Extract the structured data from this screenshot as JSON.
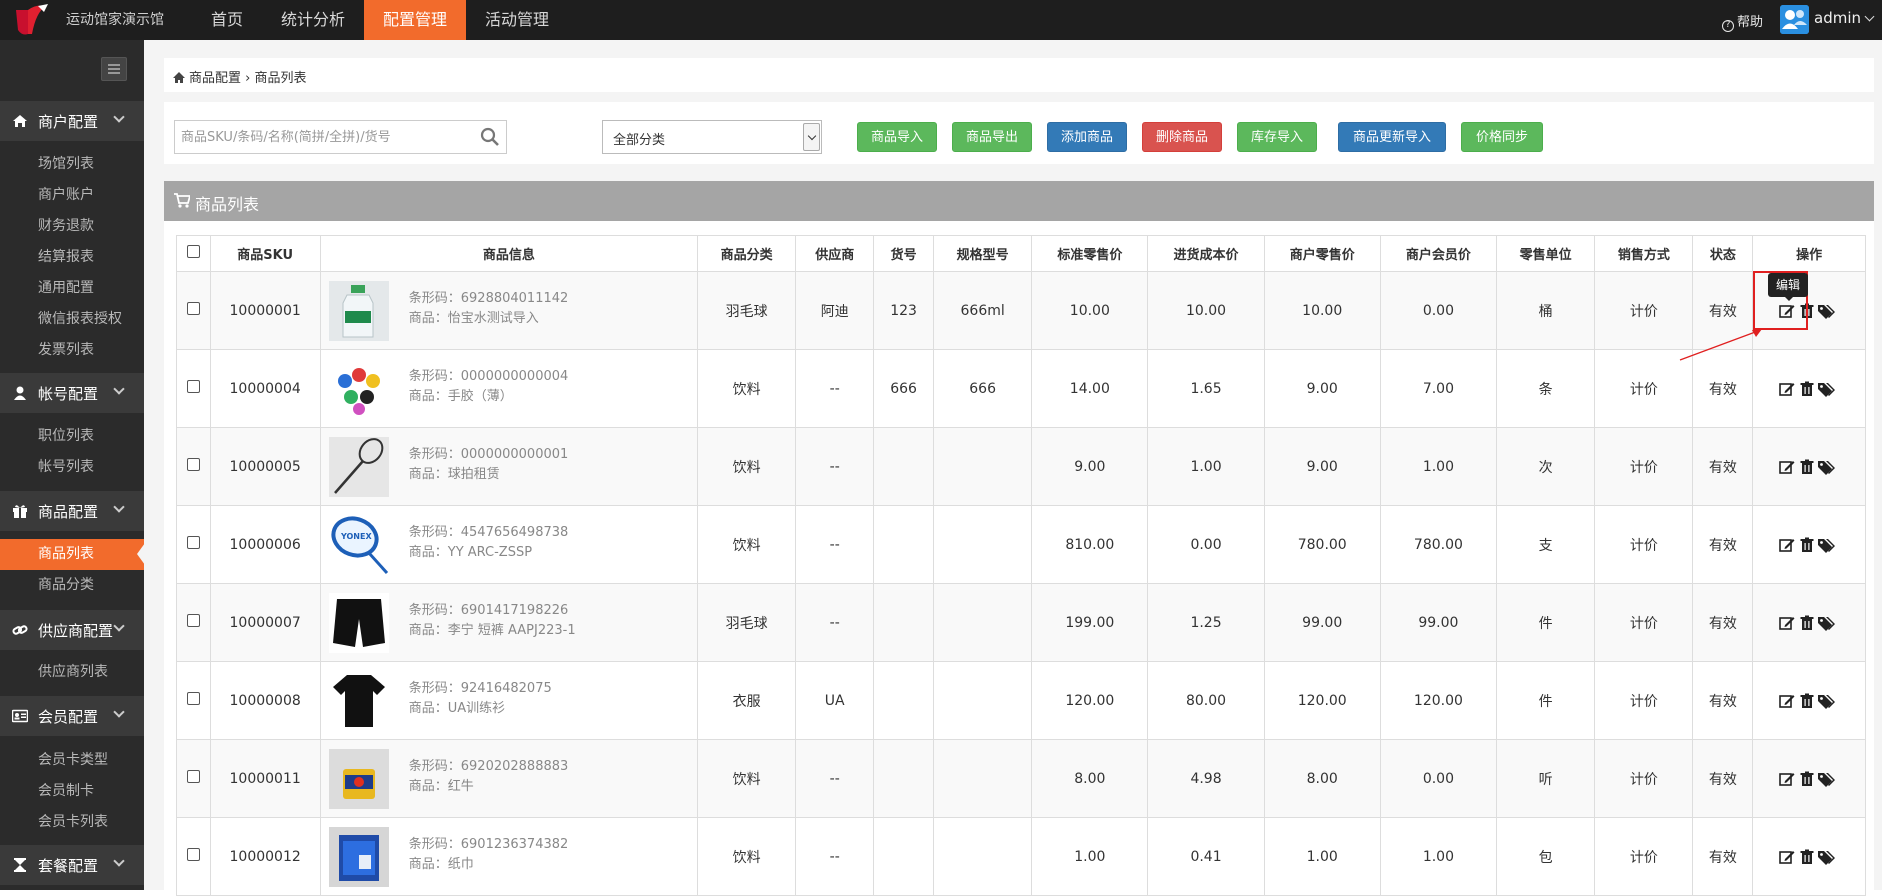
{
  "app": {
    "logo_text": "运动馆家演示馆",
    "nav": [
      {
        "label": "首页",
        "active": false
      },
      {
        "label": "统计分析",
        "active": false
      },
      {
        "label": "配置管理",
        "active": true
      },
      {
        "label": "活动管理",
        "active": false
      }
    ],
    "help_label": "帮助",
    "user_label": "admin",
    "accent_color": "#f26b2c"
  },
  "sidebar": {
    "groups": [
      {
        "label": "商户配置",
        "icon": "home-icon",
        "items": [
          {
            "label": "场馆列表"
          },
          {
            "label": "商户账户"
          },
          {
            "label": "财务退款"
          },
          {
            "label": "结算报表"
          },
          {
            "label": "通用配置"
          },
          {
            "label": "微信报表授权"
          },
          {
            "label": "发票列表"
          }
        ]
      },
      {
        "label": "帐号配置",
        "icon": "user-icon",
        "items": [
          {
            "label": "职位列表"
          },
          {
            "label": "帐号列表"
          }
        ]
      },
      {
        "label": "商品配置",
        "icon": "gift-icon",
        "items": [
          {
            "label": "商品列表",
            "active": true
          },
          {
            "label": "商品分类"
          }
        ]
      },
      {
        "label": "供应商配置",
        "icon": "link-icon",
        "items": [
          {
            "label": "供应商列表"
          }
        ]
      },
      {
        "label": "会员配置",
        "icon": "id-card-icon",
        "items": [
          {
            "label": "会员卡类型"
          },
          {
            "label": "会员制卡"
          },
          {
            "label": "会员卡列表"
          }
        ]
      },
      {
        "label": "套餐配置",
        "icon": "hourglass-icon",
        "items": []
      }
    ]
  },
  "breadcrumb": {
    "part1": "商品配置",
    "separator": "›",
    "part2": "商品列表"
  },
  "toolbar": {
    "search_placeholder": "商品SKU/条码/名称(简拼/全拼)/货号",
    "category_value": "全部分类",
    "buttons": [
      {
        "label": "商品导入",
        "style": "green"
      },
      {
        "label": "商品导出",
        "style": "green"
      },
      {
        "label": "添加商品",
        "style": "blue"
      },
      {
        "label": "删除商品",
        "style": "red"
      },
      {
        "label": "库存导入",
        "style": "green"
      },
      {
        "label": "商品更新导入",
        "style": "blue"
      },
      {
        "label": "价格同步",
        "style": "green"
      }
    ]
  },
  "panel": {
    "title": "商品列表"
  },
  "table": {
    "headers": [
      "商品SKU",
      "商品信息",
      "商品分类",
      "供应商",
      "货号",
      "规格型号",
      "标准零售价",
      "进货成本价",
      "商户零售价",
      "商户会员价",
      "零售单位",
      "销售方式",
      "状态",
      "操作"
    ],
    "barcode_label": "条形码：",
    "name_label": "商品：",
    "rows": [
      {
        "sku": "10000001",
        "barcode": "6928804011142",
        "name": "怡宝水测试导入",
        "thumb": "water-bottle",
        "category": "羽毛球",
        "supplier": "阿迪",
        "item_no": "123",
        "spec": "666ml",
        "std_price": "10.00",
        "cost": "10.00",
        "retail": "10.00",
        "member": "0.00",
        "unit": "桶",
        "sale": "计价",
        "status": "有效"
      },
      {
        "sku": "10000004",
        "barcode": "0000000000004",
        "name": "手胶（薄）",
        "thumb": "grip-tapes",
        "category": "饮料",
        "supplier": "--",
        "item_no": "666",
        "spec": "666",
        "std_price": "14.00",
        "cost": "1.65",
        "retail": "9.00",
        "member": "7.00",
        "unit": "条",
        "sale": "计价",
        "status": "有效"
      },
      {
        "sku": "10000005",
        "barcode": "0000000000001",
        "name": "球拍租赁",
        "thumb": "racket-white",
        "category": "饮料",
        "supplier": "--",
        "item_no": "",
        "spec": "",
        "std_price": "9.00",
        "cost": "1.00",
        "retail": "9.00",
        "member": "1.00",
        "unit": "次",
        "sale": "计价",
        "status": "有效"
      },
      {
        "sku": "10000006",
        "barcode": "4547656498738",
        "name": "YY ARC-ZSSP",
        "thumb": "racket-blue",
        "category": "饮料",
        "supplier": "--",
        "item_no": "",
        "spec": "",
        "std_price": "810.00",
        "cost": "0.00",
        "retail": "780.00",
        "member": "780.00",
        "unit": "支",
        "sale": "计价",
        "status": "有效"
      },
      {
        "sku": "10000007",
        "barcode": "6901417198226",
        "name": "李宁 短裤 AAPJ223-1",
        "thumb": "shorts",
        "category": "羽毛球",
        "supplier": "--",
        "item_no": "",
        "spec": "",
        "std_price": "199.00",
        "cost": "1.25",
        "retail": "99.00",
        "member": "99.00",
        "unit": "件",
        "sale": "计价",
        "status": "有效"
      },
      {
        "sku": "10000008",
        "barcode": "92416482075",
        "name": "UA训练衫",
        "thumb": "tshirt",
        "category": "衣服",
        "supplier": "UA",
        "item_no": "",
        "spec": "",
        "std_price": "120.00",
        "cost": "80.00",
        "retail": "120.00",
        "member": "120.00",
        "unit": "件",
        "sale": "计价",
        "status": "有效"
      },
      {
        "sku": "10000011",
        "barcode": "6920202888883",
        "name": "红牛",
        "thumb": "redbull-can",
        "category": "饮料",
        "supplier": "--",
        "item_no": "",
        "spec": "",
        "std_price": "8.00",
        "cost": "4.98",
        "retail": "8.00",
        "member": "0.00",
        "unit": "听",
        "sale": "计价",
        "status": "有效"
      },
      {
        "sku": "10000012",
        "barcode": "6901236374382",
        "name": "纸巾",
        "thumb": "tissue-box",
        "category": "饮料",
        "supplier": "--",
        "item_no": "",
        "spec": "",
        "std_price": "1.00",
        "cost": "0.41",
        "retail": "1.00",
        "member": "1.00",
        "unit": "包",
        "sale": "计价",
        "status": "有效"
      }
    ]
  },
  "tooltip": {
    "label": "编辑"
  }
}
